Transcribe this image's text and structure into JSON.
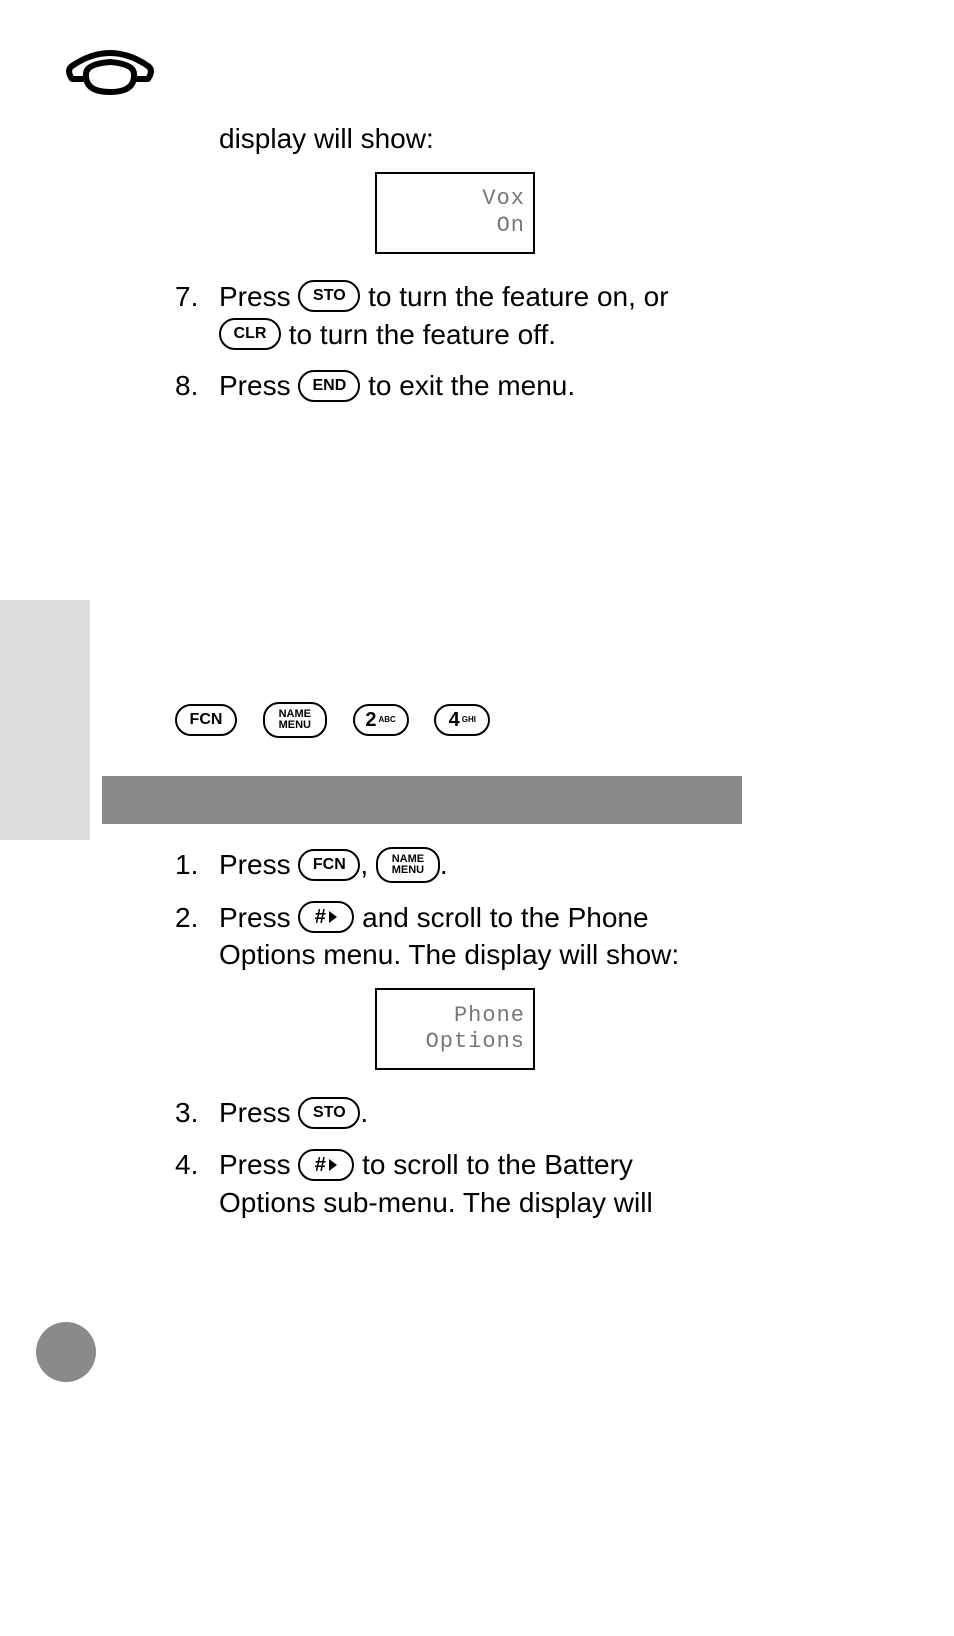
{
  "intro": "display will show:",
  "lcd1": {
    "line1": "Vox",
    "line2": "On"
  },
  "step7": {
    "num": "7.",
    "t1": "Press ",
    "t2": " to turn the feature on, or ",
    "t3": " to turn the feature off."
  },
  "step8": {
    "num": "8.",
    "t1": "Press ",
    "t2": " to exit the menu."
  },
  "keys": {
    "sto": "STO",
    "clr": "CLR",
    "end": "END",
    "fcn": "FCN",
    "name": "NAME",
    "menu": "MENU",
    "two": "2",
    "two_sub": "ABC",
    "four": "4",
    "four_sub": "GHI",
    "hash": "#"
  },
  "stepB1": {
    "num": "1.",
    "t1": "Press ",
    "sep": ", ",
    "end": "."
  },
  "stepB2": {
    "num": "2.",
    "t1": "Press ",
    "t2": " and scroll to the Phone Options menu. The display will show:"
  },
  "lcd2": {
    "line1": "Phone",
    "line2": "Options"
  },
  "stepB3": {
    "num": "3.",
    "t1": "Press ",
    "end": "."
  },
  "stepB4": {
    "num": "4.",
    "t1": "Press ",
    "t2": " to scroll to the Battery Options sub-menu. The display will"
  }
}
